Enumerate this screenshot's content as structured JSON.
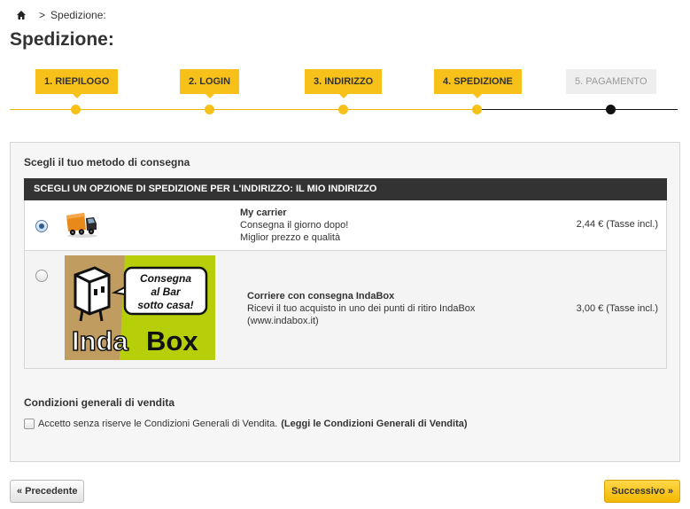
{
  "breadcrumb": {
    "separator": ">",
    "current": "Spedizione:"
  },
  "page_title": "Spedizione:",
  "steps": [
    {
      "label": "1. RIEPILOGO",
      "done": true
    },
    {
      "label": "2. LOGIN",
      "done": true
    },
    {
      "label": "3. INDIRIZZO",
      "done": true
    },
    {
      "label": "4. SPEDIZIONE",
      "done": true
    },
    {
      "label": "5. PAGAMENTO",
      "done": false
    }
  ],
  "delivery": {
    "title": "Scegli il tuo metodo di consegna",
    "table_header": "SCEGLI UN OPZIONE DI SPEDIZIONE PER L'INDIRIZZO: IL MIO INDIRIZZO",
    "options": [
      {
        "name": "My carrier",
        "line1": "Consegna il giorno dopo!",
        "line2": "Miglior prezzo e qualità",
        "price": "2,44 € (Tasse incl.)",
        "selected": true
      },
      {
        "name": "Corriere con consegna IndaBox",
        "line1": "Ricevi il tuo acquisto in uno dei punti di ritiro IndaBox",
        "line2": "(www.indabox.it)",
        "price": "3,00 € (Tasse incl.)",
        "selected": false,
        "logo": {
          "bubble_line1": "Consegna",
          "bubble_line2": "al Bar",
          "bubble_line3": "sotto casa!",
          "brand_a": "Inda",
          "brand_b": "Box"
        }
      }
    ]
  },
  "conditions": {
    "title": "Condizioni generali di vendita",
    "accept_text": "Accetto senza riserve le Condizioni Generali di Vendita.",
    "link_text": "(Leggi le Condizioni Generali di Vendita)"
  },
  "buttons": {
    "prev": "« Precedente",
    "next": "Successivo »"
  },
  "colors": {
    "accent": "#f7c11a",
    "header_bar": "#333333",
    "indabox_green": "#b7cf08"
  }
}
